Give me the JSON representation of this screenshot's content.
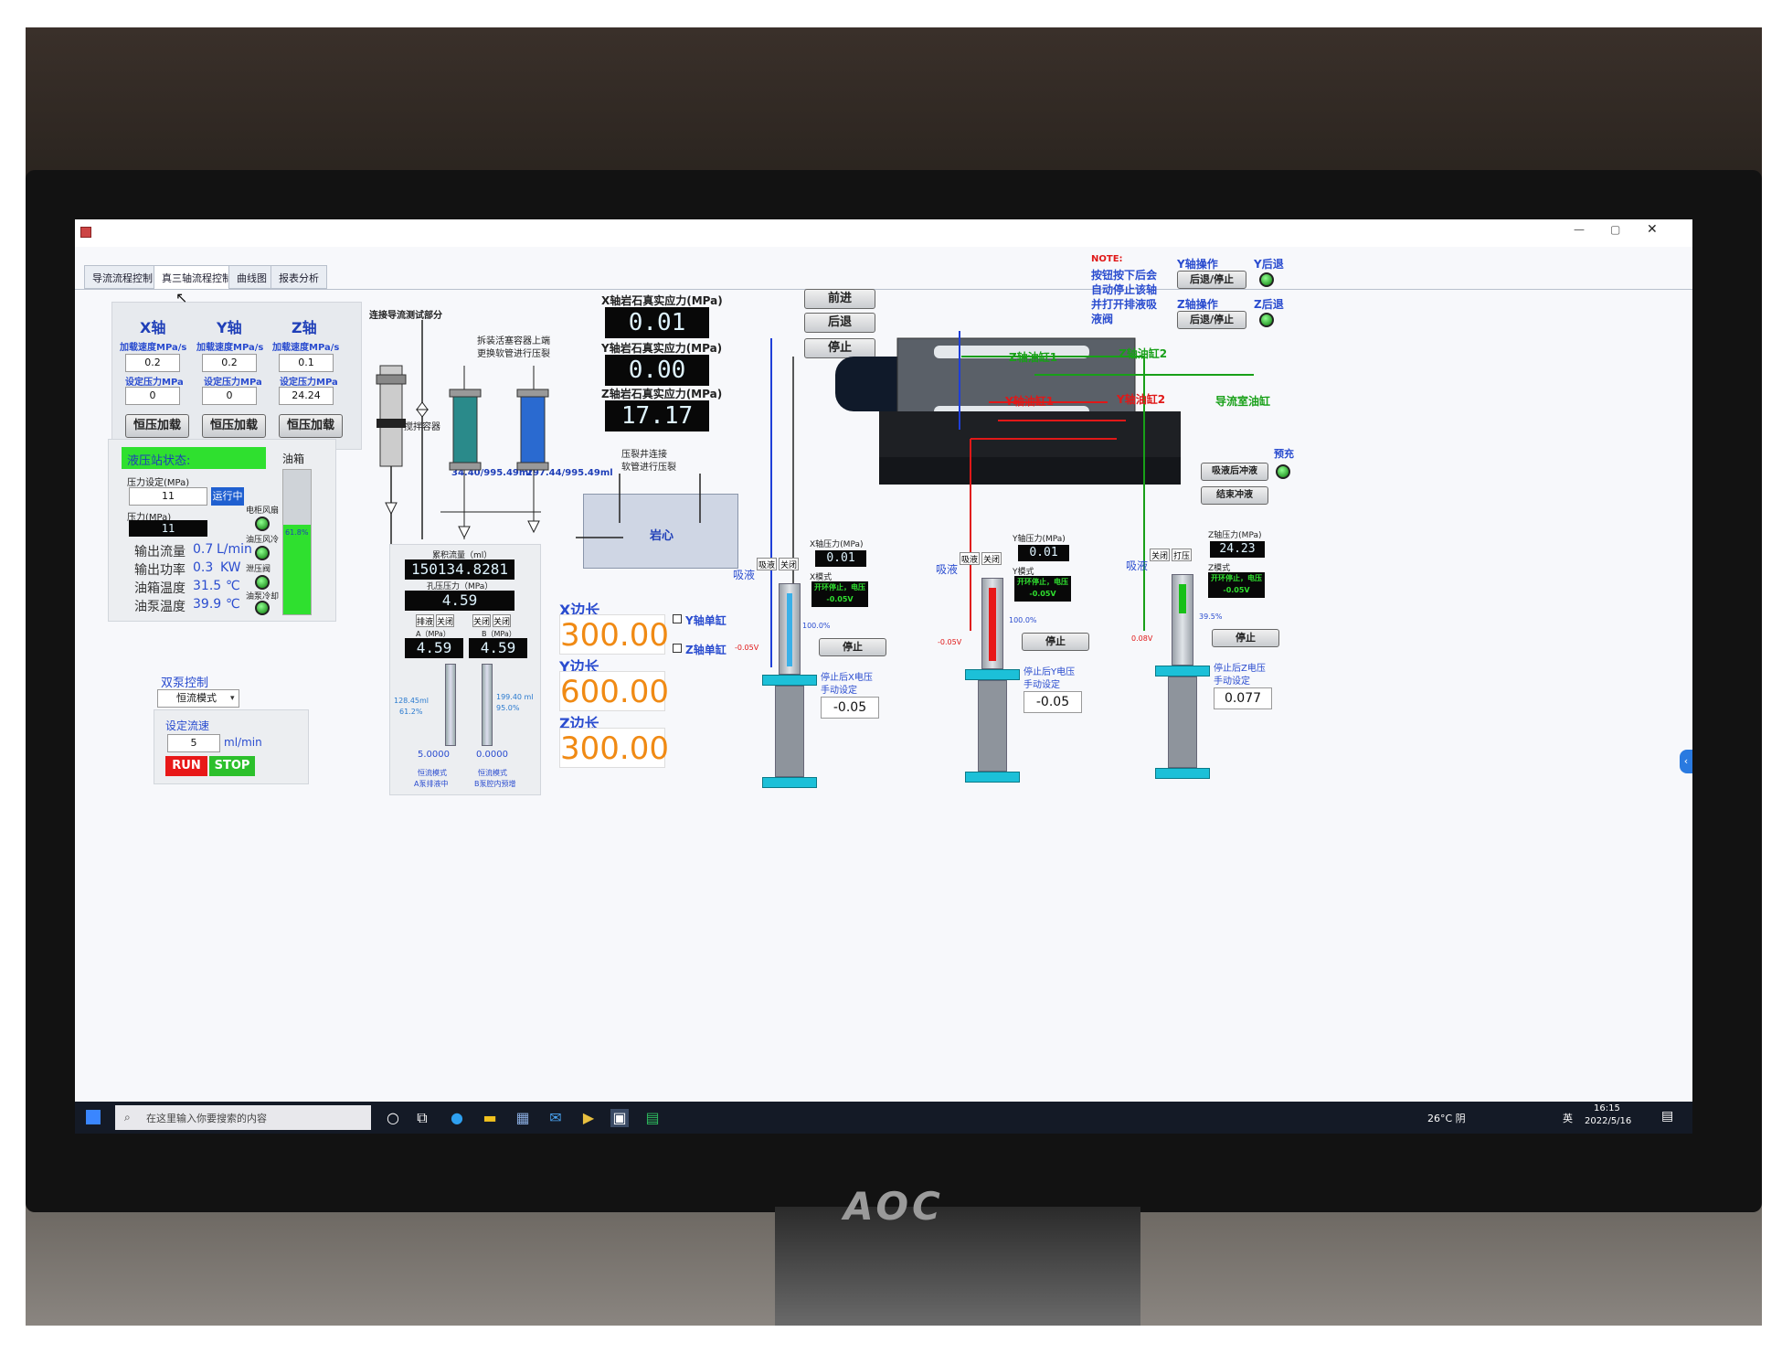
{
  "window": {
    "close": "✕",
    "minimize": "—",
    "restore": "▢"
  },
  "tabs": [
    "导流流程控制",
    "真三轴流程控制",
    "曲线图",
    "报表分析"
  ],
  "axes_panel": {
    "headers": [
      "X轴",
      "Y轴",
      "Z轴"
    ],
    "rate_label": "加载速度MPa/s",
    "pressure_label": "设定压力MPa",
    "rates": [
      "0.2",
      "0.2",
      "0.1"
    ],
    "pressures": [
      "0",
      "0",
      "24.24"
    ],
    "button": "恒压加载"
  },
  "flow_section": {
    "title": "连接导流测试部分",
    "note1": "拆装活塞容器上端",
    "note2": "更换软管进行压裂",
    "stir": "搅拌容器",
    "vol1": "34.40/995.49ml",
    "vol2": "297.44/995.49ml"
  },
  "stress": {
    "x_label": "X轴岩石真实应力(MPa)",
    "x_value": "0.01",
    "y_label": "Y轴岩石真实应力(MPa)",
    "y_value": "0.00",
    "z_label": "Z轴岩石真实应力(MPa)",
    "z_value": "17.17",
    "frac_note1": "压裂井连接",
    "frac_note2": "软管进行压裂",
    "core": "岩心"
  },
  "motion_buttons": [
    "前进",
    "后退",
    "停止"
  ],
  "hydraulic": {
    "status": "液压站状态:",
    "tank": "油箱",
    "pressure_set_label": "压力设定(MPa)",
    "pressure_set": "11",
    "running": "运行中",
    "pressure_label": "压力(MPa)",
    "pressure": "11",
    "fan": "电柜风扇",
    "oil_cool": "油压风冷",
    "relief": "泄压阀",
    "pump_cool": "油泵冷却",
    "tank_pct": "61.8%",
    "rows": [
      {
        "label": "输出流量",
        "value": "0.7",
        "unit": "L/min"
      },
      {
        "label": "输出功率",
        "value": "0.3",
        "unit": "KW"
      },
      {
        "label": "油箱温度",
        "value": "31.5",
        "unit": "℃"
      },
      {
        "label": "油泵温度",
        "value": "39.9",
        "unit": "℃"
      }
    ]
  },
  "pump": {
    "title": "双泵控制",
    "mode": "恒流模式",
    "set_label": "设定流速",
    "set_value": "5",
    "unit": "ml/min",
    "run": "RUN",
    "stop": "STOP"
  },
  "accum": {
    "label": "累积流量（ml）",
    "value": "150134.8281",
    "pore_label": "孔压压力（MPa）",
    "pore_value": "4.59",
    "drain": "排液",
    "close": "关闭",
    "a_label": "A（MPa）",
    "b_label": "B（MPa）",
    "a_value": "4.59",
    "b_value": "4.59",
    "a_vol": "128.45ml",
    "a_pct": "61.2%",
    "b_vol": "199.40 ml",
    "b_pct": "95.0%",
    "a_flow": "5.0000",
    "b_flow": "0.0000",
    "a_mode1": "恒流模式",
    "a_mode2": "A泵排液中",
    "b_mode1": "恒流模式",
    "b_mode2": "B泵腔内预增"
  },
  "edges": {
    "x_label": "X边长",
    "x_value": "300.00",
    "y_label": "Y边长",
    "y_value": "600.00",
    "z_label": "Z边长",
    "z_value": "300.00",
    "y_single": "Y轴单缸",
    "z_single": "Z轴单缸"
  },
  "machine": {
    "z_cyl1": "Z轴油缸1",
    "z_cyl2": "Z轴油缸2",
    "y_cyl1": "Y轴油缸1",
    "y_cyl2": "Y轴油缸2",
    "guide": "导流室油缸"
  },
  "note": {
    "title": "NOTE:",
    "lines": [
      "按钮按下后会",
      "自动停止该轴",
      "并打开排液吸",
      "液阀"
    ]
  },
  "ops": {
    "y_op": "Y轴操作",
    "y_back": "Y后退",
    "y_btn": "后退/停止",
    "z_op": "Z轴操作",
    "z_back": "Z后退",
    "z_btn": "后退/停止",
    "prefill": "预充",
    "flush_start": "吸液后冲液",
    "flush_end": "结束冲液"
  },
  "cylinders": [
    {
      "suck": "吸液",
      "btn_suck": "吸液",
      "btn_close": "关闭",
      "p_label": "X轴压力(MPa)",
      "p_value": "0.01",
      "mode": "X模式",
      "status1": "开环停止，电压",
      "status2": "-0.05V",
      "volt": "-0.05V",
      "pct": "100.0%",
      "stop": "停止",
      "note1": "停止后X电压",
      "note2": "手动设定",
      "set": "-0.05"
    },
    {
      "suck": "吸液",
      "btn_suck": "吸液",
      "btn_close": "关闭",
      "p_label": "Y轴压力(MPa)",
      "p_value": "0.01",
      "mode": "Y模式",
      "status1": "开环停止，电压",
      "status2": "-0.05V",
      "volt": "-0.05V",
      "pct": "100.0%",
      "stop": "停止",
      "note1": "停止后Y电压",
      "note2": "手动设定",
      "set": "-0.05"
    },
    {
      "suck": "吸液",
      "btn_suck": "关闭",
      "btn_close": "打压",
      "p_label": "Z轴压力(MPa)",
      "p_value": "24.23",
      "mode": "Z模式",
      "status1": "开环停止，电压",
      "status2": "-0.05V",
      "volt": "0.08V",
      "pct": "39.5%",
      "stop": "停止",
      "note1": "停止后Z电压",
      "note2": "手动设定",
      "set": "0.077"
    }
  ],
  "taskbar": {
    "search": "在这里输入你要搜索的内容",
    "weather": "26°C 阴",
    "lang": "英",
    "time": "16:15",
    "date": "2022/5/16"
  },
  "monitor_brand": "AOC"
}
